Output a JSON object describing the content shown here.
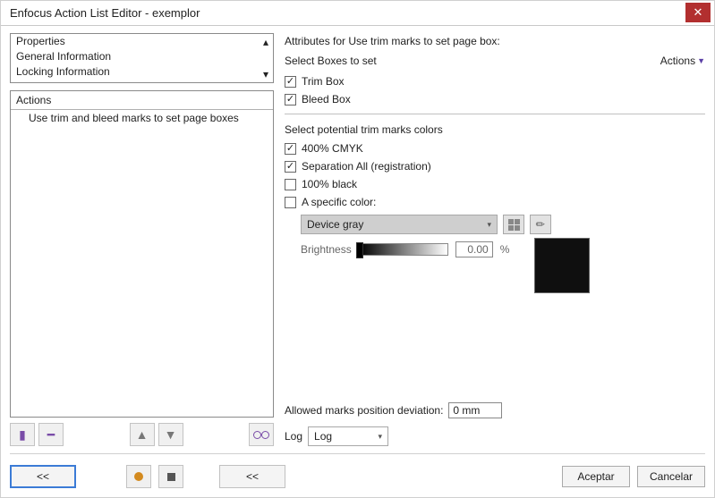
{
  "window": {
    "title": "Enfocus Action List Editor - exemplor"
  },
  "left": {
    "properties": [
      "Properties",
      "General Information",
      "Locking Information"
    ],
    "actions_header": "Actions",
    "actions_items": [
      "Use trim and bleed marks to set page boxes"
    ]
  },
  "attrs": {
    "heading": "Attributes for Use trim marks to set page box:",
    "boxes_label": "Select Boxes to set",
    "actions_link": "Actions",
    "trim_box": {
      "label": "Trim Box",
      "checked": true
    },
    "bleed_box": {
      "label": "Bleed Box",
      "checked": true
    },
    "colors_label": "Select potential trim marks colors",
    "c400": {
      "label": "400% CMYK",
      "checked": true
    },
    "sepall": {
      "label": "Separation All (registration)",
      "checked": true
    },
    "black100": {
      "label": "100% black",
      "checked": false
    },
    "specific": {
      "label": "A specific color:",
      "checked": false
    },
    "colorspace_value": "Device gray",
    "brightness_label": "Brightness",
    "brightness_value": "0.00",
    "brightness_unit": "%",
    "deviation_label": "Allowed marks position deviation:",
    "deviation_value": "0 mm",
    "log_label": "Log",
    "log_value": "Log"
  },
  "buttons": {
    "back": "<<",
    "accept": "Aceptar",
    "cancel": "Cancelar"
  }
}
